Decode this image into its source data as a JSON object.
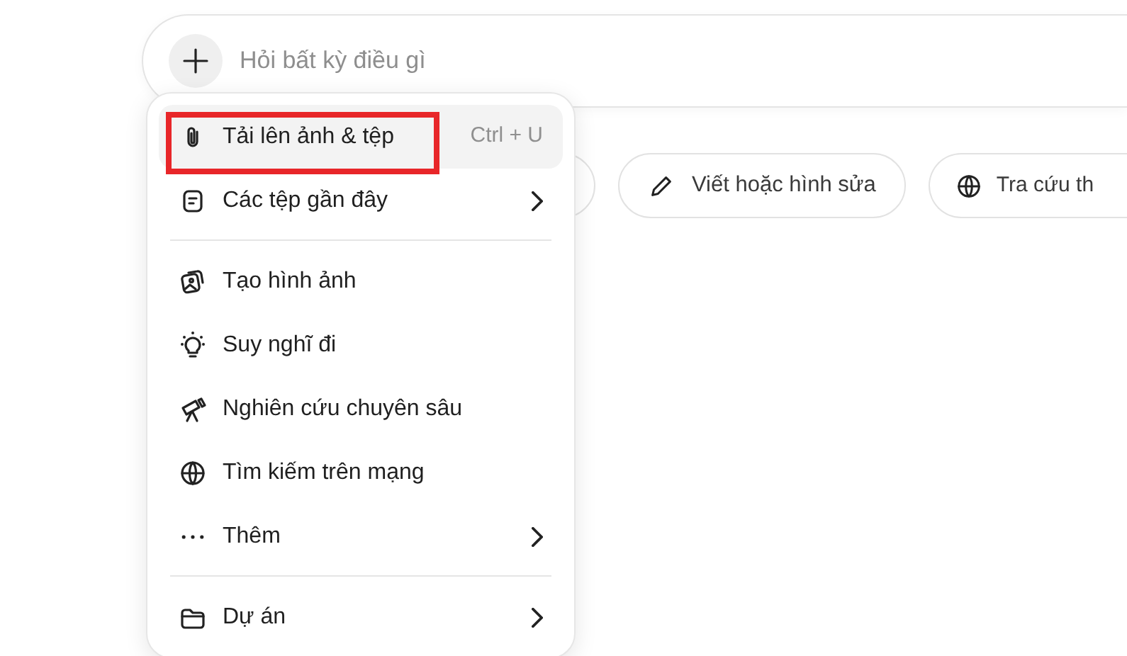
{
  "composer": {
    "placeholder": "Hỏi bất kỳ điều gì"
  },
  "suggestions": [
    {
      "label": "Viết hoặc hình sửa"
    },
    {
      "label": "Tra cứu th"
    }
  ],
  "menu": {
    "groups": [
      [
        {
          "label": "Tải lên ảnh & tệp",
          "shortcut": "Ctrl + U",
          "submenu": false,
          "selected": true,
          "annotated": true
        },
        {
          "label": "Các tệp gần đây",
          "submenu": true,
          "selected": false,
          "annotated": false
        }
      ],
      [
        {
          "label": "Tạo hình ảnh",
          "submenu": false,
          "selected": false,
          "annotated": false
        },
        {
          "label": "Suy nghĩ đi",
          "submenu": false,
          "selected": false,
          "annotated": false
        },
        {
          "label": "Nghiên cứu chuyên sâu",
          "submenu": false,
          "selected": false,
          "annotated": false
        },
        {
          "label": "Tìm kiếm trên mạng",
          "submenu": false,
          "selected": false,
          "annotated": false
        },
        {
          "label": "Thêm",
          "submenu": true,
          "selected": false,
          "annotated": false
        }
      ],
      [
        {
          "label": "Dự án",
          "submenu": true,
          "selected": false,
          "annotated": false
        }
      ]
    ]
  }
}
